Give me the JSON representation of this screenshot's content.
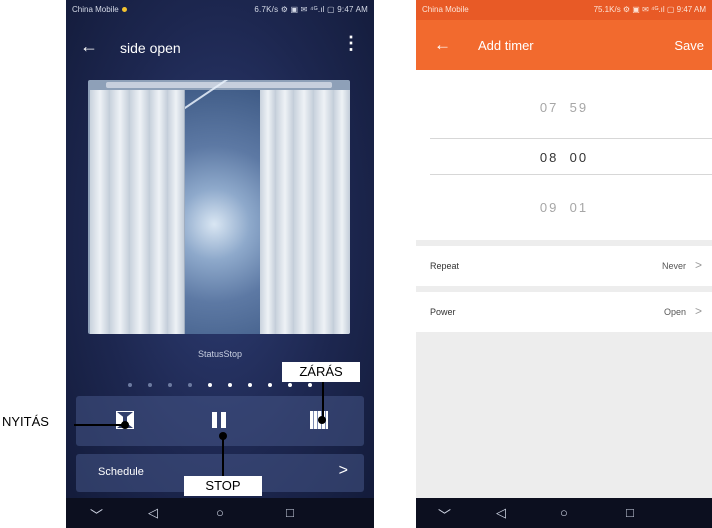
{
  "left_screen": {
    "status_bar": {
      "carrier": "China Mobile",
      "right": "6.7K/s ⚙ ▣ ✉ ⁴ᴳ.ıl ▢ 9:47 AM"
    },
    "header": {
      "back_icon": "arrow-left-icon",
      "title": "side open",
      "menu_icon": "more-vertical-icon"
    },
    "status_text": "StatusStop",
    "page_dots": {
      "total": 10,
      "active_from": 5
    },
    "controls": {
      "open_icon": "curtain-open-icon",
      "pause_icon": "pause-icon",
      "close_icon": "curtain-close-icon"
    },
    "schedule": {
      "label": "Schedule",
      "chevron": ">"
    },
    "nav": {
      "back": "◁",
      "home": "○",
      "recents": "□",
      "down": "﹀"
    }
  },
  "right_screen": {
    "status_bar": {
      "carrier": "China Mobile",
      "right": "75.1K/s ⚙ ▣ ✉ ⁴ᴳ.ıl ▢ 9:47 AM"
    },
    "header": {
      "back_icon": "arrow-left-icon",
      "title": "Add timer",
      "save": "Save"
    },
    "picker": {
      "prev": {
        "hour": "07",
        "minute": "59"
      },
      "selected": {
        "hour": "08",
        "minute": "00"
      },
      "next": {
        "hour": "09",
        "minute": "01"
      }
    },
    "options": [
      {
        "label": "Repeat",
        "value": "Never",
        "chevron": ">"
      },
      {
        "label": "Power",
        "value": "Open",
        "chevron": ">"
      }
    ],
    "nav": {
      "back": "◁",
      "home": "○",
      "recents": "□",
      "down": "﹀"
    }
  },
  "annotations": {
    "open": "NYITÁS",
    "close": "ZÁRÁS",
    "stop": "STOP"
  },
  "colors": {
    "accent_orange": "#f26a2e",
    "left_bg": "#1f2b55"
  }
}
